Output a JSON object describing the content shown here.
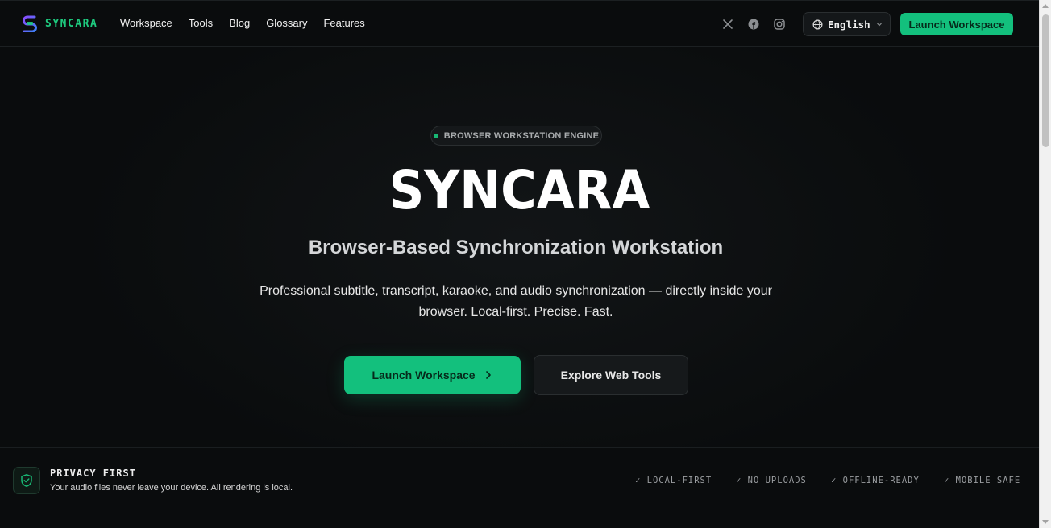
{
  "brand": {
    "name": "SYNCARA"
  },
  "nav": {
    "links": [
      "Workspace",
      "Tools",
      "Blog",
      "Glossary",
      "Features"
    ],
    "social_icons": [
      "x-icon",
      "facebook-icon",
      "instagram-icon"
    ],
    "language": "English",
    "cta": "Launch Workspace"
  },
  "hero": {
    "badge": "BROWSER WORKSTATION ENGINE",
    "title": "SYNCARA",
    "subtitle": "Browser-Based Synchronization Workstation",
    "description": "Professional subtitle, transcript, karaoke, and audio synchronization — directly inside your browser. Local-first. Precise. Fast.",
    "primary_button": "Launch Workspace",
    "secondary_button": "Explore Web Tools"
  },
  "privacy": {
    "title": "PRIVACY FIRST",
    "description": "Your audio files never leave your device. All rendering is local.",
    "features": [
      "✓ LOCAL-FIRST",
      "✓ NO UPLOADS",
      "✓ OFFLINE-READY",
      "✓ MOBILE SAFE"
    ]
  },
  "colors": {
    "accent": "#13c07d",
    "background": "#0a0c0d",
    "logo_gradient": [
      "#7b4dff",
      "#3b82f6"
    ]
  }
}
